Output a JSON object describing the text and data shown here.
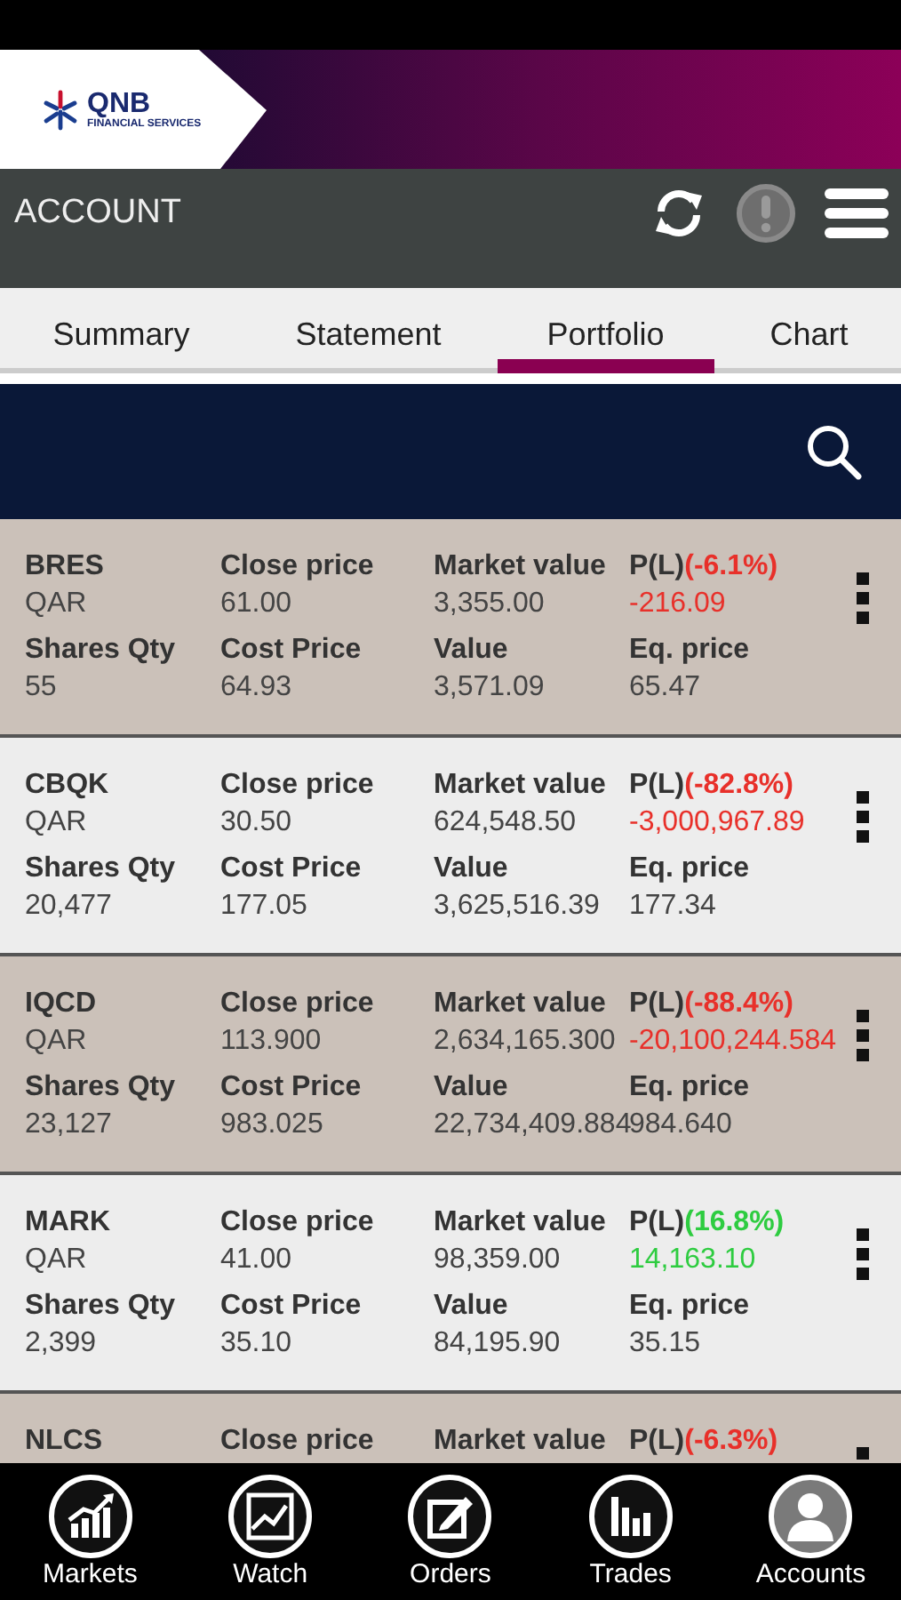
{
  "brand": {
    "name": "QNB",
    "tagline": "FINANCIAL SERVICES"
  },
  "account_bar": {
    "title": "ACCOUNT"
  },
  "tabs": [
    {
      "label": "Summary",
      "selected": false
    },
    {
      "label": "Statement",
      "selected": false
    },
    {
      "label": "Portfolio",
      "selected": true
    },
    {
      "label": "Chart",
      "selected": false
    }
  ],
  "holdings": [
    {
      "cells": [
        {
          "label": "BRES",
          "value": "QAR"
        },
        {
          "label": "Close price",
          "value": "61.00"
        },
        {
          "label": "Market value",
          "value": "3,355.00"
        },
        {
          "label": "P(L)",
          "change": "(-6.1%)",
          "value": "-216.09",
          "color": "#e8302a"
        },
        {
          "label": "Shares Qty",
          "value": "55"
        },
        {
          "label": "Cost Price",
          "value": "64.93"
        },
        {
          "label": "Value",
          "value": "3,571.09"
        },
        {
          "label": "Eq. price",
          "value": "65.47"
        }
      ]
    },
    {
      "cells": [
        {
          "label": "CBQK",
          "value": "QAR"
        },
        {
          "label": "Close price",
          "value": "30.50"
        },
        {
          "label": "Market value",
          "value": "624,548.50"
        },
        {
          "label": "P(L)",
          "change": "(-82.8%)",
          "value": "-3,000,967.89",
          "color": "#e8302a"
        },
        {
          "label": "Shares Qty",
          "value": "20,477"
        },
        {
          "label": "Cost Price",
          "value": "177.05"
        },
        {
          "label": "Value",
          "value": "3,625,516.39"
        },
        {
          "label": "Eq. price",
          "value": "177.34"
        }
      ]
    },
    {
      "cells": [
        {
          "label": "IQCD",
          "value": "QAR"
        },
        {
          "label": "Close price",
          "value": "113.900"
        },
        {
          "label": "Market value",
          "value": "2,634,165.300"
        },
        {
          "label": "P(L)",
          "change": "(-88.4%)",
          "value": "-20,100,244.584",
          "color": "#e8302a"
        },
        {
          "label": "Shares Qty",
          "value": "23,127"
        },
        {
          "label": "Cost Price",
          "value": "983.025"
        },
        {
          "label": "Value",
          "value": "22,734,409.884"
        },
        {
          "label": "Eq. price",
          "value": "984.640"
        }
      ]
    },
    {
      "cells": [
        {
          "label": "MARK",
          "value": "QAR"
        },
        {
          "label": "Close price",
          "value": "41.00"
        },
        {
          "label": "Market value",
          "value": "98,359.00"
        },
        {
          "label": "P(L)",
          "change": "(16.8%)",
          "value": "14,163.10",
          "color": "#2ecc40"
        },
        {
          "label": "Shares Qty",
          "value": "2,399"
        },
        {
          "label": "Cost Price",
          "value": "35.10"
        },
        {
          "label": "Value",
          "value": "84,195.90"
        },
        {
          "label": "Eq. price",
          "value": "35.15"
        }
      ]
    },
    {
      "cells": [
        {
          "label": "NLCS"
        },
        {
          "label": "Close price"
        },
        {
          "label": "Market value"
        },
        {
          "label": "P(L)",
          "change": "(-6.3%)",
          "color": "#e8302a"
        }
      ]
    }
  ],
  "bottom_nav": [
    {
      "kind": "markets",
      "label": "Markets",
      "selected": false
    },
    {
      "kind": "watch",
      "label": "Watch",
      "selected": false
    },
    {
      "kind": "orders",
      "label": "Orders",
      "selected": false
    },
    {
      "kind": "trades",
      "label": "Trades",
      "selected": false
    },
    {
      "kind": "accounts",
      "label": "Accounts",
      "selected": true
    }
  ]
}
